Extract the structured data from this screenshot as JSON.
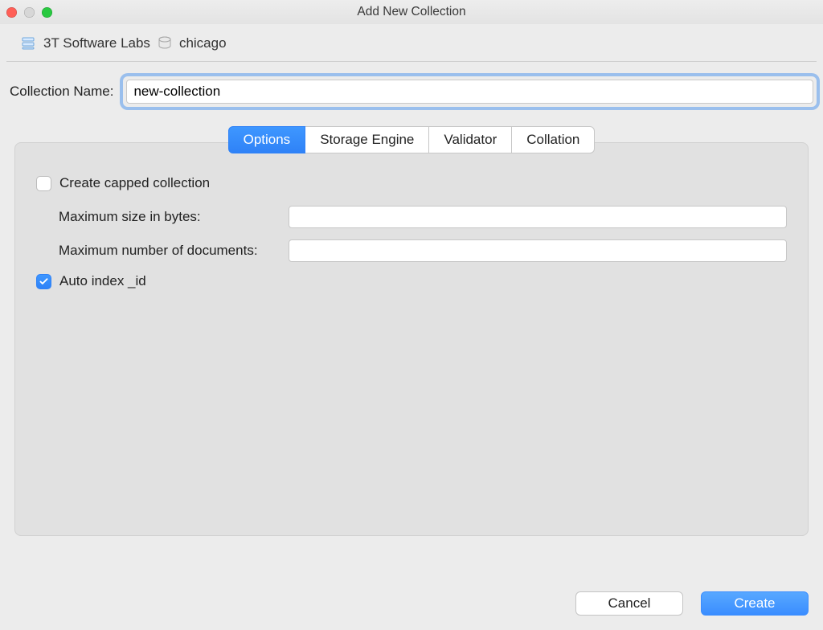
{
  "window": {
    "title": "Add New Collection"
  },
  "breadcrumb": {
    "connection": "3T Software Labs",
    "database": "chicago"
  },
  "form": {
    "collection_name_label": "Collection Name:",
    "collection_name_value": "new-collection"
  },
  "tabs": {
    "options": "Options",
    "storage_engine": "Storage Engine",
    "validator": "Validator",
    "collation": "Collation"
  },
  "options": {
    "create_capped_label": "Create capped collection",
    "create_capped_checked": false,
    "max_size_label": "Maximum size in bytes:",
    "max_size_value": "",
    "max_docs_label": "Maximum number of documents:",
    "max_docs_value": "",
    "auto_index_label": "Auto index _id",
    "auto_index_checked": true
  },
  "footer": {
    "cancel": "Cancel",
    "create": "Create"
  }
}
